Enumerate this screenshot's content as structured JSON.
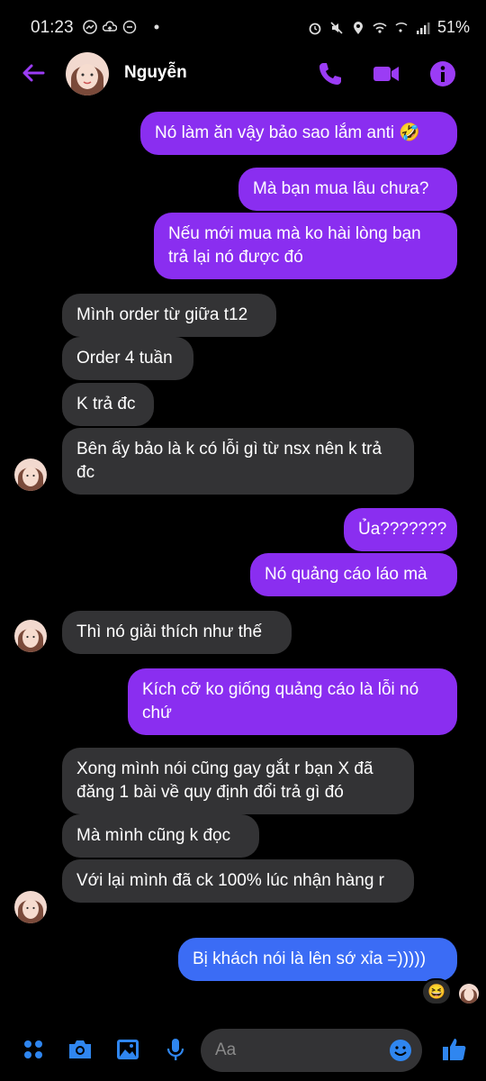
{
  "status": {
    "time": "01:23",
    "battery": "51%",
    "left_icons": [
      "messenger-icon",
      "upload-cloud-icon",
      "do-not-disturb-icon",
      "dot-icon"
    ],
    "right_icons": [
      "alarm-icon",
      "mute-icon",
      "location-icon",
      "wifi-icon",
      "wifi-call-icon",
      "signal-icon"
    ]
  },
  "header": {
    "contact_name": "Nguyễn",
    "actions": [
      "phone-icon",
      "video-icon",
      "info-icon"
    ]
  },
  "colors": {
    "accent": "#8a2ef0",
    "blue_bubble": "#4e5cf2",
    "incoming_bubble": "#333335"
  },
  "messages": [
    {
      "dir": "out",
      "text": "Nó làm ăn vậy bảo sao lắm anti 🤣"
    },
    {
      "dir": "out",
      "text": "Mà bạn mua lâu chưa?"
    },
    {
      "dir": "out",
      "text": "Nếu mới mua mà ko hài lòng bạn trả lại nó được đó"
    },
    {
      "dir": "in",
      "text": "Mình order từ giữa t12"
    },
    {
      "dir": "in",
      "text": "Order 4 tuần"
    },
    {
      "dir": "in",
      "text": "K trả đc"
    },
    {
      "dir": "in",
      "text": "Bên ấy bảo là k có lỗi gì từ nsx nên k trả đc"
    },
    {
      "dir": "out",
      "text": "Ủa???????"
    },
    {
      "dir": "out",
      "text": "Nó quảng cáo láo mà"
    },
    {
      "dir": "in",
      "text": "Thì nó giải thích như thế"
    },
    {
      "dir": "out",
      "text": "Kích cỡ ko giống quảng cáo là lỗi nó chứ"
    },
    {
      "dir": "in",
      "text": "Xong mình nói cũng gay gắt r bạn X đã đăng 1 bài về quy định đổi trả gì đó"
    },
    {
      "dir": "in",
      "text": "Mà mình cũng k đọc"
    },
    {
      "dir": "in",
      "text": "Với lại mình đã ck 100% lúc nhận hàng r"
    },
    {
      "dir": "out",
      "text": "Bị khách nói là lên sớ xỉa =)))))"
    }
  ],
  "reaction": "😆",
  "composer": {
    "placeholder": "Aa",
    "icons": [
      "menu-grid-icon",
      "camera-icon",
      "gallery-icon",
      "microphone-icon",
      "emoji-icon",
      "like-icon"
    ]
  }
}
